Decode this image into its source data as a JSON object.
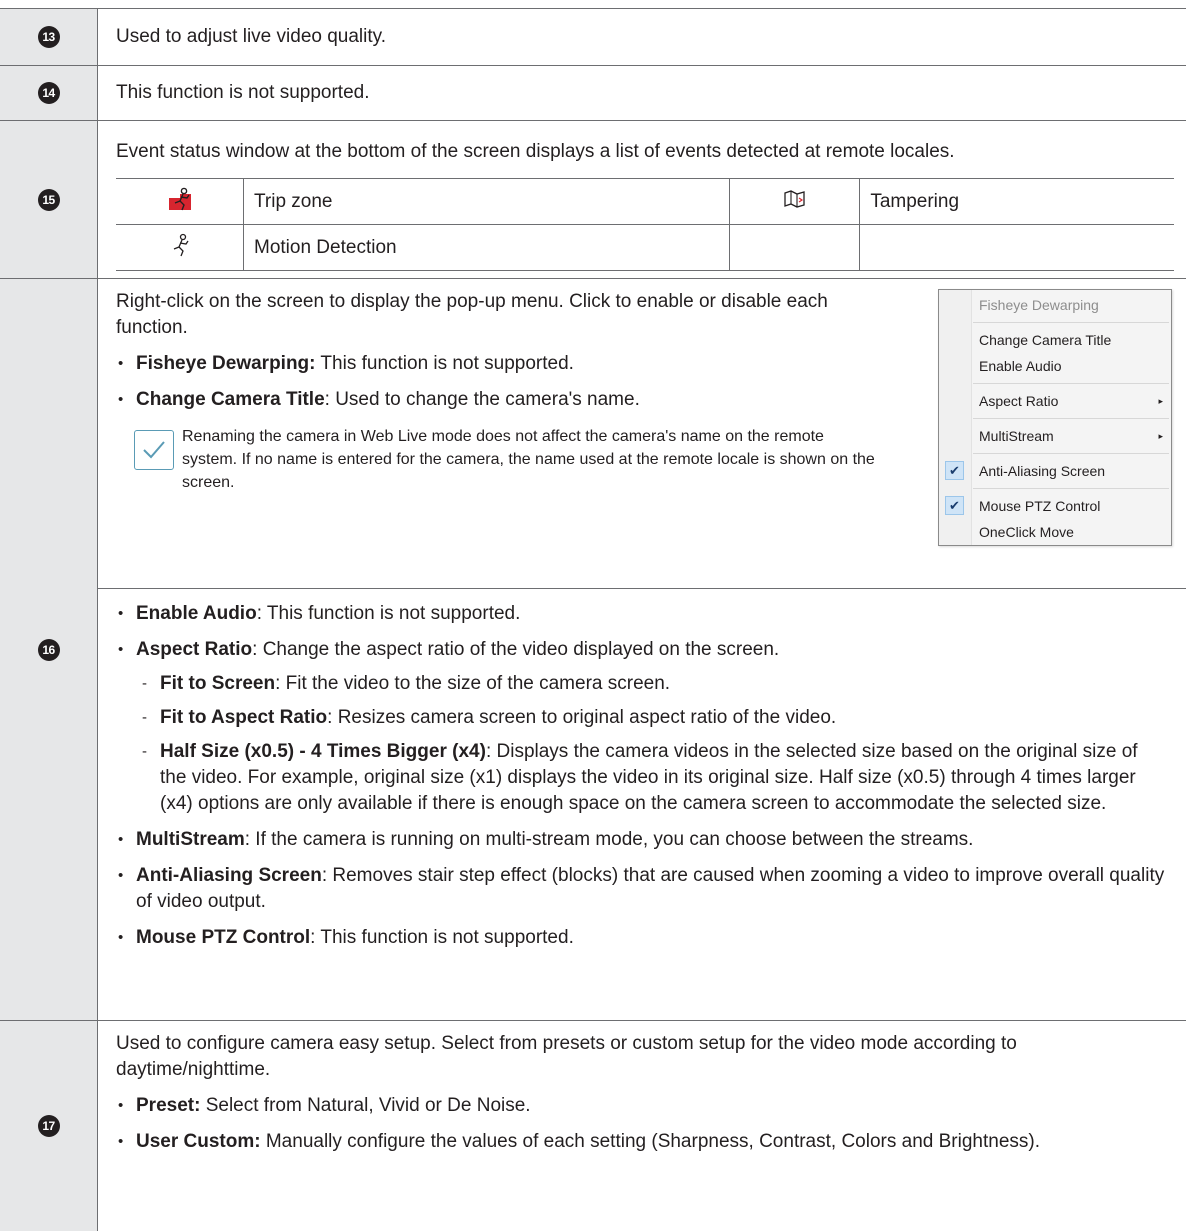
{
  "rows": {
    "r13": {
      "number": "13",
      "text": "Used to adjust live video quality."
    },
    "r14": {
      "number": "14",
      "text": "This function is not supported."
    },
    "r15": {
      "number": "15",
      "text": "Event status window at the bottom of the screen displays a list of events detected at remote locales.",
      "events": {
        "trip_zone": {
          "icon": "trip-zone-icon",
          "label": "Trip zone"
        },
        "tampering": {
          "icon": "tampering-icon",
          "label": "Tampering"
        },
        "motion_detection": {
          "icon": "motion-detection-icon",
          "label": "Motion Detection"
        }
      }
    },
    "r16": {
      "number": "16",
      "intro": "Right-click on the screen to display the pop-up menu. Click to enable or disable each function.",
      "fisheye": {
        "term": "Fisheye Dewarping:",
        "desc": " This function is not supported."
      },
      "change_title": {
        "term": "Change Camera Title",
        "desc": ": Used to change the camera's name."
      },
      "note": "Renaming the camera in Web Live mode does not affect the camera's name on the remote system. If no name is entered for the camera, the name used at the remote locale is shown on the screen.",
      "enable_audio": {
        "term": "Enable Audio",
        "desc": ": This function is not supported."
      },
      "aspect_ratio": {
        "term": "Aspect Ratio",
        "desc": ": Change the aspect ratio of the video displayed on the screen."
      },
      "fit_screen": {
        "term": "Fit to Screen",
        "desc": ": Fit the video to the size of the camera screen."
      },
      "fit_aspect": {
        "term": "Fit to Aspect Ratio",
        "desc": ": Resizes camera screen to original aspect ratio of the video."
      },
      "half_size": {
        "term": "Half Size (x0.5) - 4 Times Bigger (x4)",
        "desc": ": Displays the camera videos in the selected size based on the original size of the video. For example, original size (x1) displays the video in its original size. Half size (x0.5) through 4 times larger (x4) options are only available if there is enough space on the camera screen to accommodate the selected size."
      },
      "multistream": {
        "term": "MultiStream",
        "desc": ": If the camera is running on multi-stream mode, you can choose between the streams."
      },
      "anti_aliasing": {
        "term": "Anti-Aliasing Screen",
        "desc": ": Removes stair step effect (blocks) that are caused when zooming a video to improve overall quality of video output."
      },
      "mouse_ptz": {
        "term": "Mouse PTZ Control",
        "desc": ":  This function is not supported."
      },
      "menu": {
        "fisheye": "Fisheye Dewarping",
        "change_title": "Change Camera Title",
        "enable_audio": "Enable Audio",
        "aspect_ratio": "Aspect Ratio",
        "multistream": "MultiStream",
        "anti_aliasing": "Anti-Aliasing Screen",
        "mouse_ptz": "Mouse PTZ Control",
        "oneclick": "OneClick Move",
        "submenu_arrow": "▸",
        "check": "✔"
      }
    },
    "r17": {
      "number": "17",
      "intro": "Used to configure camera easy setup. Select from presets or custom setup for the video mode according to daytime/nighttime.",
      "preset": {
        "term": "Preset:",
        "desc": " Select from Natural, Vivid or De Noise."
      },
      "user_custom": {
        "term": "User Custom:",
        "desc": " Manually configure the values of each setting (Sharpness, Contrast, Colors and Brightness)."
      }
    }
  },
  "colors": {
    "number_cell_bg": "#e6e7e8",
    "border": "#6d6e71",
    "trip_zone_red": "#d7252f",
    "note_icon": "#5a9bb5"
  }
}
